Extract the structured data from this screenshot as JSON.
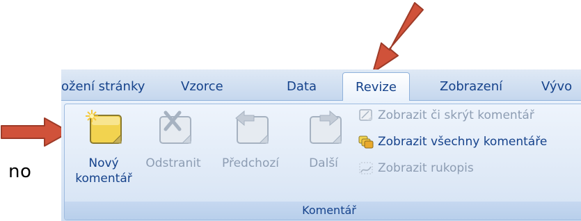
{
  "outside_text": "no",
  "tabs": [
    {
      "label": "ožení stránky",
      "active": false
    },
    {
      "label": "Vzorce",
      "active": false
    },
    {
      "label": "Data",
      "active": false
    },
    {
      "label": "Revize",
      "active": true
    },
    {
      "label": "Zobrazení",
      "active": false
    },
    {
      "label": "Vývo",
      "active": false
    }
  ],
  "group": {
    "label": "Komentář",
    "buttons": {
      "new_comment": {
        "line1": "Nový",
        "line2": "komentář",
        "icon": "new-comment-icon"
      },
      "delete": {
        "label": "Odstranit",
        "icon": "delete-comment-icon"
      },
      "previous": {
        "label": "Předchozí",
        "icon": "previous-comment-icon"
      },
      "next": {
        "label": "Další",
        "icon": "next-comment-icon"
      }
    },
    "small_buttons": {
      "show_hide": {
        "label": "Zobrazit či skrýt komentář",
        "icon": "show-hide-comment-icon"
      },
      "show_all": {
        "label": "Zobrazit všechny komentáře",
        "icon": "show-all-comments-icon"
      },
      "show_ink": {
        "label": "Zobrazit rukopis",
        "icon": "show-ink-icon"
      }
    }
  },
  "colors": {
    "arrow": "#d0523a",
    "ribbon_text": "#15428b",
    "disabled_text": "#8d9db3",
    "comment_yellow": "#f2d34f"
  }
}
